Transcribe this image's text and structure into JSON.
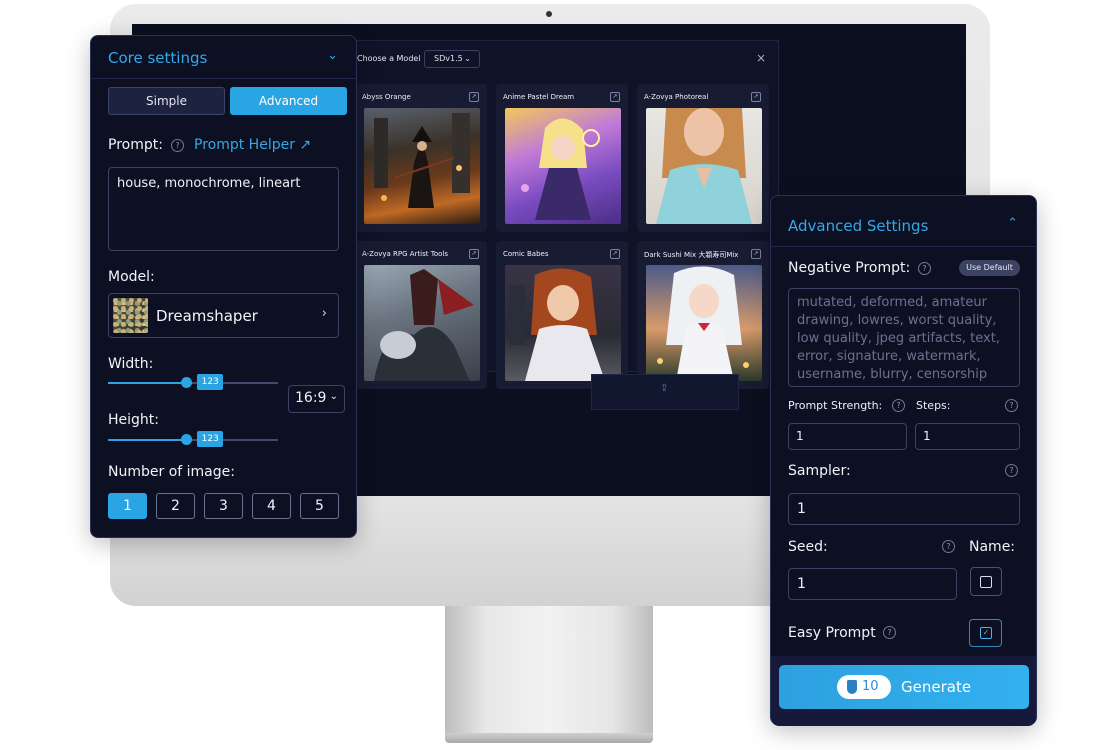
{
  "model_modal": {
    "title": "Choose a Model",
    "version": "SDv1.5",
    "close_glyph": "×",
    "upload_glyph": "⇪",
    "cards": [
      {
        "name": "Abyss Orange"
      },
      {
        "name": "Anime Pastel Dream"
      },
      {
        "name": "A-Zovya Photoreal"
      },
      {
        "name": "A-Zovya RPG Artist Tools"
      },
      {
        "name": "Comic Babes"
      },
      {
        "name": "Dark Sushi Mix 大顆寿司Mix"
      }
    ]
  },
  "core": {
    "title": "Core settings",
    "modes": {
      "simple": "Simple",
      "advanced": "Advanced",
      "selected": "Advanced"
    },
    "prompt_label": "Prompt:",
    "prompt_helper": "Prompt Helper ↗",
    "prompt_value": "house, monochrome, lineart",
    "model_label": "Model:",
    "model_value": "Dreamshaper",
    "width_label": "Width:",
    "width_value": "123",
    "width_fraction": 0.46,
    "height_label": "Height:",
    "height_value": "123",
    "height_fraction": 0.46,
    "aspect_ratio": "16:9",
    "num_label": "Number of image:",
    "num_options": [
      "1",
      "2",
      "3",
      "4",
      "5"
    ],
    "num_selected": "1"
  },
  "advanced": {
    "title": "Advanced Settings",
    "negative_label": "Negative Prompt:",
    "use_default": "Use Default",
    "negative_placeholder": "mutated, deformed, amateur drawing, lowres, worst quality, low quality, jpeg artifacts, text, error, signature, watermark, username, blurry, censorship",
    "prompt_strength_label": "Prompt Strength:",
    "prompt_strength_value": "1",
    "steps_label": "Steps:",
    "steps_value": "1",
    "sampler_label": "Sampler:",
    "sampler_value": "1",
    "seed_label": "Seed:",
    "seed_value": "1",
    "name_label": "Name:",
    "name_checked": false,
    "easy_prompt_label": "Easy Prompt",
    "easy_prompt_checked": true,
    "credits": "10",
    "generate_label": "Generate"
  },
  "help_glyph": "?",
  "colors": {
    "accent": "#2aa5e4",
    "panel_bg": "#0c1022",
    "screen_bg": "#0c0f1f"
  }
}
